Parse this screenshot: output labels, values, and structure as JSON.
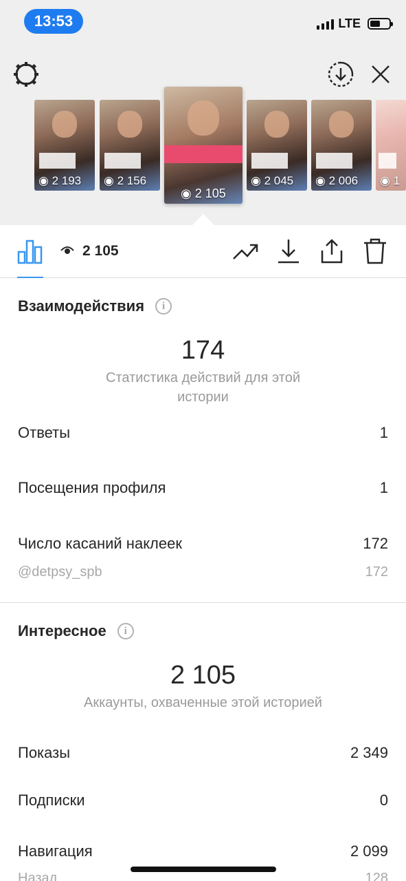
{
  "status_bar": {
    "time": "13:53",
    "network": "LTE"
  },
  "stories": [
    {
      "views": "2 193",
      "style": "dark"
    },
    {
      "views": "2 156",
      "style": "dark"
    },
    {
      "views": "2 105",
      "style": "active"
    },
    {
      "views": "2 045",
      "style": "dark"
    },
    {
      "views": "2 006",
      "style": "dark"
    },
    {
      "views": "1",
      "style": "light"
    }
  ],
  "toolbar": {
    "views": "2 105"
  },
  "interactions": {
    "title": "Взаимодействия",
    "total": "174",
    "total_caption": "Статистика действий для этой истории",
    "rows": [
      {
        "label": "Ответы",
        "value": "1"
      },
      {
        "label": "Посещения профиля",
        "value": "1"
      },
      {
        "label": "Число касаний наклеек",
        "value": "172"
      }
    ],
    "sticker_sub": {
      "label": "@detpsy_spb",
      "value": "172"
    }
  },
  "discovery": {
    "title": "Интересное",
    "total": "2 105",
    "total_caption": "Аккаунты, охваченные этой историей",
    "rows": [
      {
        "label": "Показы",
        "value": "2 349"
      },
      {
        "label": "Подписки",
        "value": "0"
      },
      {
        "label": "Навигация",
        "value": "2 099"
      }
    ],
    "nav_sub": {
      "label": "Назад",
      "value": "128"
    }
  },
  "colors": {
    "accent": "#3897f0",
    "time_pill": "#1f7cf0",
    "text": "#262626",
    "muted": "#9a9a9a"
  }
}
